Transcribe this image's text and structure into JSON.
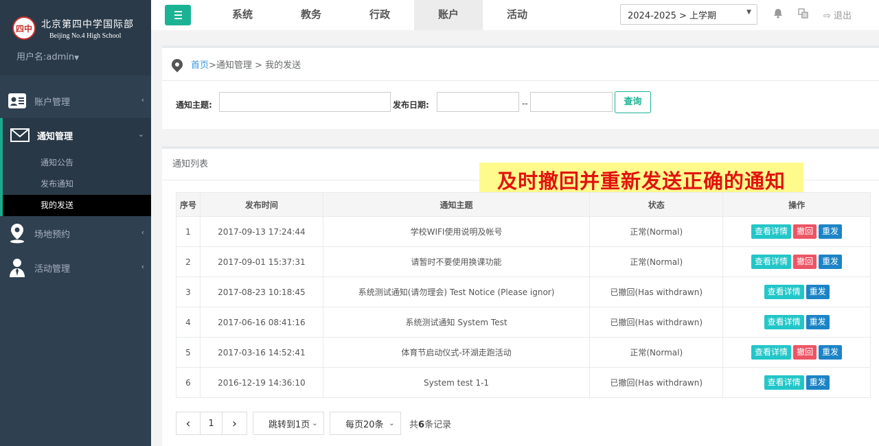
{
  "school": {
    "name_cn": "北京第四中学国际部",
    "name_en": "Beijing No.4 High School",
    "seal_text": "四中"
  },
  "user": {
    "label": "用户名:admin"
  },
  "sidebar": {
    "items": [
      {
        "label": "账户管理",
        "icon": "id-card-icon"
      },
      {
        "label": "通知管理",
        "icon": "envelope-icon"
      },
      {
        "label": "场地预约",
        "icon": "map-marker-icon"
      },
      {
        "label": "活动管理",
        "icon": "user-tie-icon"
      }
    ],
    "sub_items": [
      "通知公告",
      "发布通知",
      "我的发送"
    ]
  },
  "topbar": {
    "tabs": [
      "系统",
      "教务",
      "行政",
      "账户",
      "活动"
    ],
    "active_tab": "账户",
    "term": "2024-2025 > 上学期",
    "logout": "退出"
  },
  "breadcrumb": {
    "home": "首页",
    "rest": " >通知管理 > 我的发送"
  },
  "search": {
    "subject_label": "通知主题:",
    "subject_value": "",
    "date_label": "发布日期:",
    "date_from": "",
    "date_sep": "--",
    "date_to": "",
    "query_button": "查询"
  },
  "list": {
    "title": "通知列表",
    "banner": "及时撤回并重新发送正确的通知",
    "columns": [
      "序号",
      "发布时间",
      "通知主题",
      "状态",
      "操作"
    ],
    "rows": [
      {
        "no": "1",
        "time": "2017-09-13 17:24:44",
        "subject": "学校WIFI使用说明及帐号",
        "status": "正常(Normal)",
        "ops": [
          "查看详情",
          "撤回",
          "重发"
        ]
      },
      {
        "no": "2",
        "time": "2017-09-01 15:37:31",
        "subject": "请暂时不要使用换课功能",
        "status": "正常(Normal)",
        "ops": [
          "查看详情",
          "撤回",
          "重发"
        ]
      },
      {
        "no": "3",
        "time": "2017-08-23 10:18:45",
        "subject": "系统测试通知(请勿理会) Test Notice (Please ignor)",
        "status": "已撤回(Has withdrawn)",
        "ops": [
          "查看详情",
          "重发"
        ]
      },
      {
        "no": "4",
        "time": "2017-06-16 08:41:16",
        "subject": "系统测试通知 System Test",
        "status": "已撤回(Has withdrawn)",
        "ops": [
          "查看详情",
          "重发"
        ]
      },
      {
        "no": "5",
        "time": "2017-03-16 14:52:41",
        "subject": "体育节启动仪式-环湖走跑活动",
        "status": "正常(Normal)",
        "ops": [
          "查看详情",
          "撤回",
          "重发"
        ]
      },
      {
        "no": "6",
        "time": "2016-12-19 14:36:10",
        "subject": "System test 1-1",
        "status": "已撤回(Has withdrawn)",
        "ops": [
          "查看详情",
          "重发"
        ]
      }
    ]
  },
  "pager": {
    "prev": "‹",
    "page": "1",
    "next": "›",
    "jump": "跳转到1页",
    "per_page": "每页20条",
    "total_prefix": "共",
    "total_count": "6",
    "total_suffix": "条记录"
  },
  "colors": {
    "sidebar_bg": "#2f4050",
    "accent": "#1ab394",
    "view_btn": "#23c6c8",
    "recall_btn": "#ed5565",
    "resend_btn": "#1c84c6",
    "banner_bg": "#fffa8c",
    "banner_text": "#e1130f"
  }
}
